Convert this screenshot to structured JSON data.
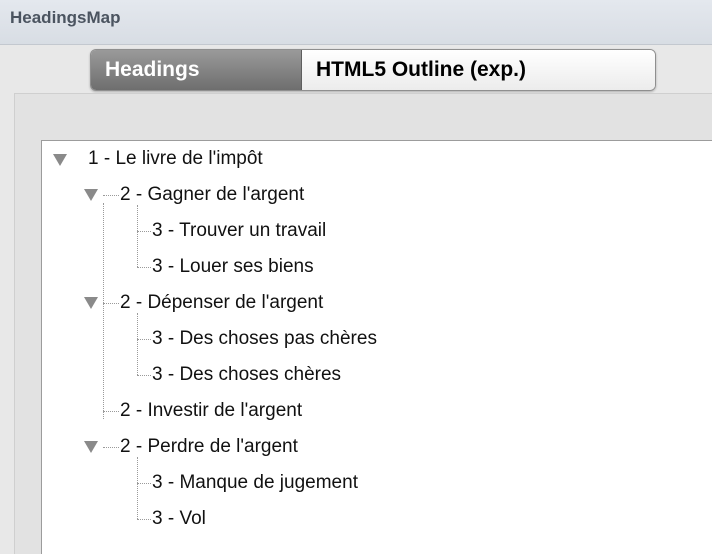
{
  "app": {
    "title": "HeadingsMap"
  },
  "tabs": [
    {
      "label": "Headings",
      "active": true
    },
    {
      "label": "HTML5 Outline (exp.)",
      "active": false
    }
  ],
  "colors": {
    "active_tab": "#7a7a7a",
    "tree_bg": "#ffffff",
    "connector": "#9a9a9a"
  },
  "tree": {
    "items": [
      {
        "label": "1 - Le livre de l'impôt",
        "level": 1,
        "expanded": true
      },
      {
        "label": "2 - Gagner de l'argent",
        "level": 2,
        "expanded": true
      },
      {
        "label": "3 - Trouver un travail",
        "level": 3
      },
      {
        "label": "3 - Louer ses biens",
        "level": 3
      },
      {
        "label": "2 - Dépenser de l'argent",
        "level": 2,
        "expanded": true
      },
      {
        "label": "3 - Des choses pas chères",
        "level": 3
      },
      {
        "label": "3 - Des choses chères",
        "level": 3
      },
      {
        "label": "2 - Investir de l'argent",
        "level": 2
      },
      {
        "label": "2 - Perdre de l'argent",
        "level": 2,
        "expanded": true
      },
      {
        "label": "3 - Manque de jugement",
        "level": 3
      },
      {
        "label": "3 - Vol",
        "level": 3
      }
    ]
  }
}
